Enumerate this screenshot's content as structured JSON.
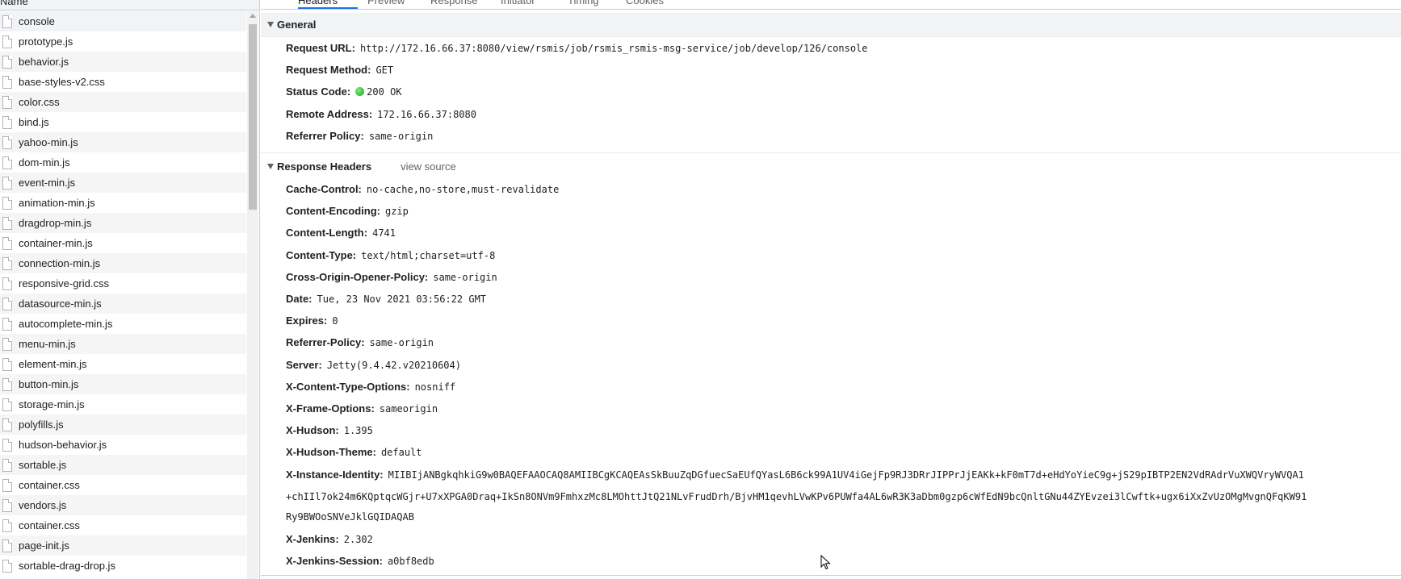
{
  "request_list": {
    "column_header": "Name",
    "items": [
      "console",
      "prototype.js",
      "behavior.js",
      "base-styles-v2.css",
      "color.css",
      "bind.js",
      "yahoo-min.js",
      "dom-min.js",
      "event-min.js",
      "animation-min.js",
      "dragdrop-min.js",
      "container-min.js",
      "connection-min.js",
      "responsive-grid.css",
      "datasource-min.js",
      "autocomplete-min.js",
      "menu-min.js",
      "element-min.js",
      "button-min.js",
      "storage-min.js",
      "polyfills.js",
      "hudson-behavior.js",
      "sortable.js",
      "container.css",
      "vendors.js",
      "container.css",
      "page-init.js",
      "sortable-drag-drop.js"
    ]
  },
  "tabs": [
    "Headers",
    "Preview",
    "Response",
    "Initiator",
    "Timing",
    "Cookies"
  ],
  "general": {
    "title": "General",
    "rows": [
      {
        "name": "Request URL:",
        "value": "http://172.16.66.37:8080/view/rsmis/job/rsmis_rsmis-msg-service/job/develop/126/console"
      },
      {
        "name": "Request Method:",
        "value": "GET"
      },
      {
        "name": "Status Code:",
        "value": "200 OK"
      },
      {
        "name": "Remote Address:",
        "value": "172.16.66.37:8080"
      },
      {
        "name": "Referrer Policy:",
        "value": "same-origin"
      }
    ]
  },
  "response_headers": {
    "title": "Response Headers",
    "view_source": "view source",
    "rows": [
      {
        "name": "Cache-Control:",
        "value": "no-cache,no-store,must-revalidate"
      },
      {
        "name": "Content-Encoding:",
        "value": "gzip"
      },
      {
        "name": "Content-Length:",
        "value": "4741"
      },
      {
        "name": "Content-Type:",
        "value": "text/html;charset=utf-8"
      },
      {
        "name": "Cross-Origin-Opener-Policy:",
        "value": "same-origin"
      },
      {
        "name": "Date:",
        "value": "Tue, 23 Nov 2021 03:56:22 GMT"
      },
      {
        "name": "Expires:",
        "value": "0"
      },
      {
        "name": "Referrer-Policy:",
        "value": "same-origin"
      },
      {
        "name": "Server:",
        "value": "Jetty(9.4.42.v20210604)"
      },
      {
        "name": "X-Content-Type-Options:",
        "value": "nosniff"
      },
      {
        "name": "X-Frame-Options:",
        "value": "sameorigin"
      },
      {
        "name": "X-Hudson:",
        "value": "1.395"
      },
      {
        "name": "X-Hudson-Theme:",
        "value": "default"
      }
    ],
    "instance_identity": {
      "name": "X-Instance-Identity:",
      "line1": "MIIBIjANBgkqhkiG9w0BAQEFAAOCAQ8AMIIBCgKCAQEAsSkBuuZqDGfuecSaEUfQYasL6B6ck99A1UV4iGejFp9RJ3DRrJIPPrJjEAKk+kF0mT7d+eHdYoYieC9g+jS29pIBTP2EN2VdRAdrVuXWQVryWVQA1",
      "line2": "+chIIl7ok24m6KQptqcWGjr+U7xXPGA0Draq+IkSn8ONVm9FmhxzMc8LMOhttJtQ21NLvFrudDrh/BjvHM1qevhLVwKPv6PUWfa4AL6wR3K3aDbm0gzp6cWfEdN9bcQnltGNu44ZYEvzei3lCwftk+ugx6iXxZvUzOMgMvgnQFqKW91",
      "line3": "Ry9BWOoSNVeJklGQIDAQAB"
    },
    "rows_after": [
      {
        "name": "X-Jenkins:",
        "value": "2.302"
      },
      {
        "name": "X-Jenkins-Session:",
        "value": "a0bf8edb"
      }
    ]
  }
}
